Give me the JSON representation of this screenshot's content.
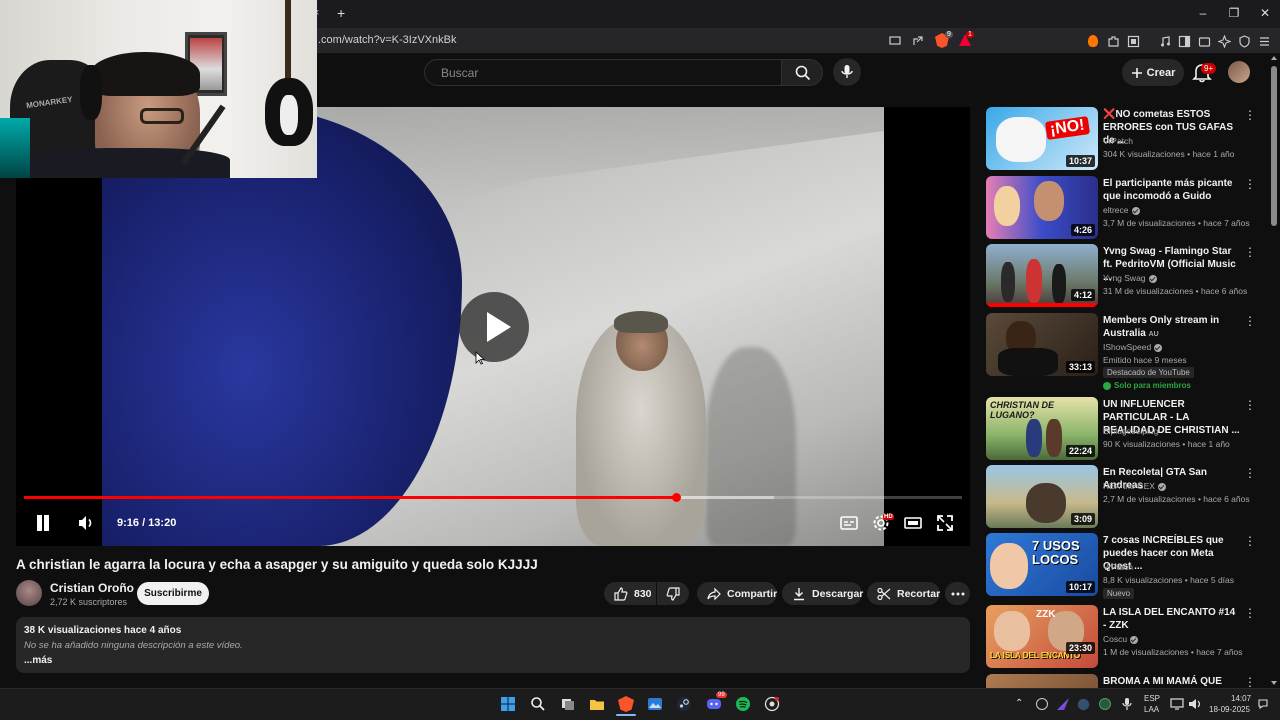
{
  "browser": {
    "url": ".com/watch?v=K-3IzVXnkBk",
    "new_tab": "+",
    "tab_close": "×",
    "window_minimize": "–",
    "window_restore": "❐",
    "window_close": "✕",
    "brave_badge": "9",
    "ext_badge": "1"
  },
  "header": {
    "search_placeholder": "Buscar",
    "create_label": "Crear",
    "notifications_badge": "9+"
  },
  "player": {
    "time_display": "9:16 / 13:20",
    "current_seconds": 556,
    "duration_seconds": 800,
    "buffered_fraction": 0.8,
    "hd_badge": "HD"
  },
  "video": {
    "title": "A christian le agarra la locura y echa a asapger y su amiguito y queda solo KJJJJ",
    "channel_name": "Cristian Oroño",
    "subscribers": "2,72 K suscriptores",
    "subscribe_label": "Suscribirme",
    "likes": "830",
    "share_label": "Compartir",
    "download_label": "Descargar",
    "clip_label": "Recortar"
  },
  "description": {
    "meta": "38 K visualizaciones  hace 4 años",
    "text": "No se ha añadido ninguna descripción a este vídeo.",
    "more": "...más"
  },
  "recommendations": [
    {
      "title": "❌NO cometas ESTOS ERRORES con TUS GAFAS de ...",
      "channel": "VrPatch",
      "verified": false,
      "meta": "304 K visualizaciones • hace 1 año",
      "duration": "10:37"
    },
    {
      "title": "El participante más picante que incomodó a Guido",
      "channel": "eltrece",
      "verified": true,
      "meta": "3,7 M de visualizaciones • hace 7 años",
      "duration": "4:26"
    },
    {
      "title": "Yvng Swag - Flamingo Star ft. PedritoVM (Official Music ...",
      "channel": "Yvng Swag",
      "verified": true,
      "meta": "31 M de visualizaciones • hace 6 años",
      "duration": "4:12"
    },
    {
      "title": "Members Only stream in Australia",
      "title_suffix": "AU",
      "channel": "IShowSpeed",
      "verified": true,
      "meta": "Emitido hace 9 meses",
      "tag": "Destacado de YouTube",
      "members": "Solo para miembros",
      "duration": "33:13"
    },
    {
      "title": "UN INFLUENCER PARTICULAR - LA REALIDAD DE CHRISTIAN ...",
      "channel": "Elplugeselplug",
      "verified": false,
      "meta": "90 K visualizaciones • hace 1 año",
      "duration": "22:24"
    },
    {
      "title": "En Recoleta| GTA San Andreas",
      "channel": "REX the GEX",
      "verified": true,
      "meta": "2,7 M de visualizaciones • hace 6 años",
      "duration": "3:09"
    },
    {
      "title": "7 cosas INCREÍBLES que puedes hacer con Meta Quest ...",
      "channel": "VrPatch",
      "verified": false,
      "meta": "8,8 K visualizaciones • hace 5 días",
      "tag": "Nuevo",
      "duration": "10:17"
    },
    {
      "title": "LA ISLA DEL ENCANTO #14 - ZZK",
      "channel": "Coscu",
      "verified": true,
      "meta": "1 M de visualizaciones • hace 7 años",
      "duration": "23:30"
    },
    {
      "title": "BROMA A MI MAMÁ QUE",
      "channel": "",
      "verified": false,
      "meta": "",
      "duration": ""
    }
  ],
  "thumb_texts": {
    "no": "¡NO!",
    "christian": "CHRISTIAN DE LUGANO?",
    "usos": "7 USOS LOCOS",
    "zzk": "ZZK",
    "isla": "LA ISLA DEL ENCANTO"
  },
  "webcam": {
    "chair_brand": "MONARKEY"
  },
  "taskbar": {
    "lang_top": "ESP",
    "lang_bottom": "LAA",
    "time": "14:07",
    "date": "18-09-2025",
    "discord_badge": "99"
  },
  "colors": {
    "accent_red": "#ff0000",
    "background": "#0f0f0f",
    "surface": "#272727"
  }
}
